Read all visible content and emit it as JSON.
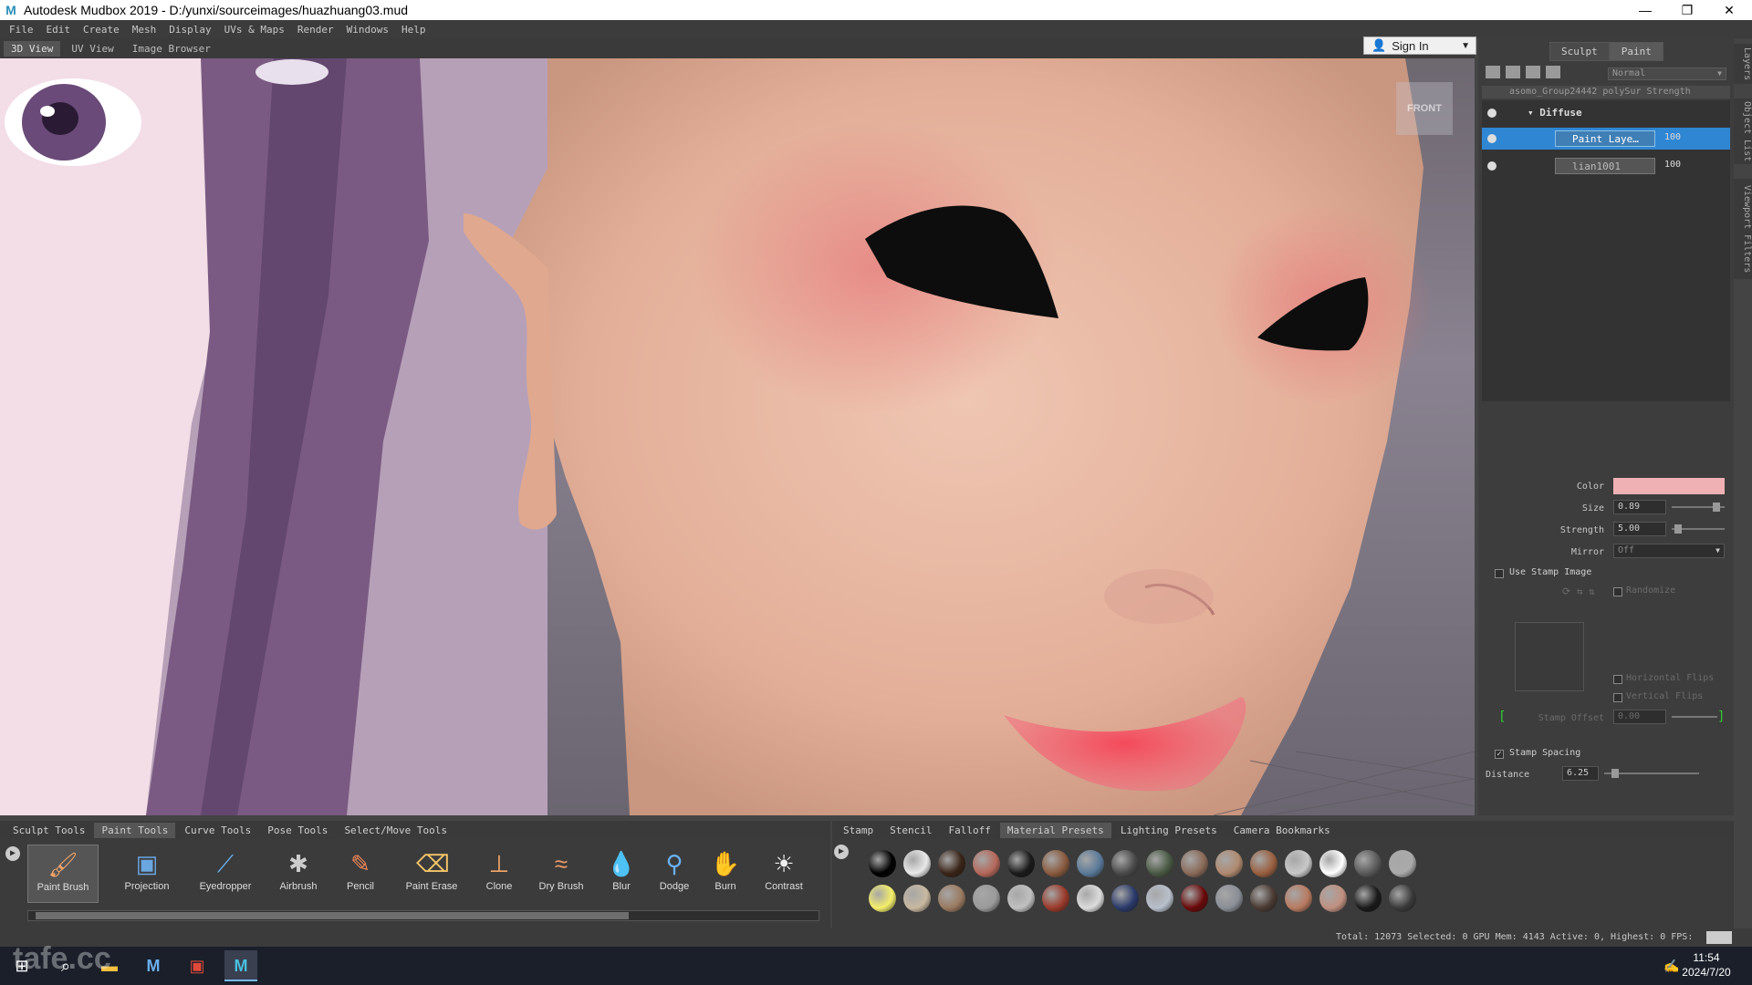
{
  "window": {
    "title": "Autodesk Mudbox 2019 - D:/yunxi/sourceimages/huazhuang03.mud",
    "logo_letter": "M",
    "controls": [
      "—",
      "❐",
      "✕"
    ]
  },
  "menu": [
    "File",
    "Edit",
    "Create",
    "Mesh",
    "Display",
    "UVs & Maps",
    "Render",
    "Windows",
    "Help"
  ],
  "view_tabs": [
    {
      "label": "3D View",
      "active": true
    },
    {
      "label": "UV View",
      "active": false
    },
    {
      "label": "Image Browser",
      "active": false
    }
  ],
  "signin": {
    "label": "Sign In"
  },
  "viewport": {
    "view_cube_label": "FRONT"
  },
  "right_panel": {
    "mode_tabs": [
      "Sculpt",
      "Paint"
    ],
    "blend_mode": "Normal",
    "layer_header": "asomo_Group24442 polySur Strength",
    "layers": [
      {
        "name": "Diffuse",
        "kind": "group"
      },
      {
        "name": "Paint Laye…",
        "opacity": "100",
        "selected": true
      },
      {
        "name": "lian1001",
        "opacity": "100",
        "selected": false
      }
    ],
    "side_tabs": [
      "Layers",
      "Object List",
      "Viewport Filters"
    ],
    "properties": {
      "color_label": "Color",
      "color_value": "#f0b1b4",
      "size_label": "Size",
      "size_value": "0.89",
      "size_level": 0.89,
      "strength_label": "Strength",
      "strength_value": "5.00",
      "strength_level": 0.05,
      "mirror_label": "Mirror",
      "mirror_value": "Off",
      "use_stamp_image": "Use Stamp Image",
      "randomize": "Randomize",
      "horizontal_flips": "Horizontal Flips",
      "vertical_flips": "Vertical Flips",
      "stamp_offset_label": "Stamp Offset",
      "stamp_offset_value": "0.00",
      "stamp_spacing": "Stamp Spacing",
      "stamp_spacing_checked": "✓",
      "distance_label": "Distance",
      "distance_value": "6.25"
    }
  },
  "tool_tabs": [
    {
      "label": "Sculpt Tools",
      "active": false
    },
    {
      "label": "Paint Tools",
      "active": true
    },
    {
      "label": "Curve Tools",
      "active": false
    },
    {
      "label": "Pose Tools",
      "active": false
    },
    {
      "label": "Select/Move Tools",
      "active": false
    }
  ],
  "tools": [
    {
      "label": "Paint Brush",
      "icon": "paint-brush-icon",
      "glyph": "🖌",
      "active": true
    },
    {
      "label": "Projection",
      "icon": "projection-icon",
      "glyph": "▣"
    },
    {
      "label": "Eyedropper",
      "icon": "eyedropper-icon",
      "glyph": "⟋"
    },
    {
      "label": "Airbrush",
      "icon": "airbrush-icon",
      "glyph": "✱"
    },
    {
      "label": "Pencil",
      "icon": "pencil-icon",
      "glyph": "✎"
    },
    {
      "label": "Paint Erase",
      "icon": "paint-erase-icon",
      "glyph": "⌫"
    },
    {
      "label": "Clone",
      "icon": "clone-icon",
      "glyph": "⊥"
    },
    {
      "label": "Dry Brush",
      "icon": "dry-brush-icon",
      "glyph": "≈"
    },
    {
      "label": "Blur",
      "icon": "blur-icon",
      "glyph": "💧"
    },
    {
      "label": "Dodge",
      "icon": "dodge-icon",
      "glyph": "⚲"
    },
    {
      "label": "Burn",
      "icon": "burn-icon",
      "glyph": "✋"
    },
    {
      "label": "Contrast",
      "icon": "contrast-icon",
      "glyph": "☀"
    }
  ],
  "material_tabs": [
    {
      "label": "Stamp",
      "active": false
    },
    {
      "label": "Stencil",
      "active": false
    },
    {
      "label": "Falloff",
      "active": false
    },
    {
      "label": "Material Presets",
      "active": true
    },
    {
      "label": "Lighting Presets",
      "active": false
    },
    {
      "label": "Camera Bookmarks",
      "active": false
    }
  ],
  "material_colors": [
    [
      "#000000",
      "#e8e8e8",
      "#3a2418",
      "#b5685a",
      "#1a1a1a",
      "#8a5a3e",
      "#5a7a9a",
      "#4a4a4a",
      "#4a5a44",
      "#8a6a58",
      "#b08a70",
      "#9a6040",
      "#c8c8c8",
      "#ffffff",
      "#5a5a5a",
      "#aaaaaa"
    ],
    [
      "#f4ee6a",
      "#c8b8a0",
      "#9a7a60",
      "#9a9a9a",
      "#c0c0c0",
      "#9a3a2a",
      "#dcdcdc",
      "#2a3a6a",
      "#b8c0cc",
      "#6a0a0a",
      "#8a8e96",
      "#4a3a32",
      "#b87a60",
      "#c09080",
      "#1a1a1a",
      "#3a3a3a"
    ]
  ],
  "status": {
    "text": "Total: 12073  Selected: 0 GPU Mem: 4143  Active: 0, Highest: 0  FPS:"
  },
  "taskbar": {
    "time": "11:54",
    "date": "2024/7/20",
    "watermark": "tafe.cc"
  }
}
